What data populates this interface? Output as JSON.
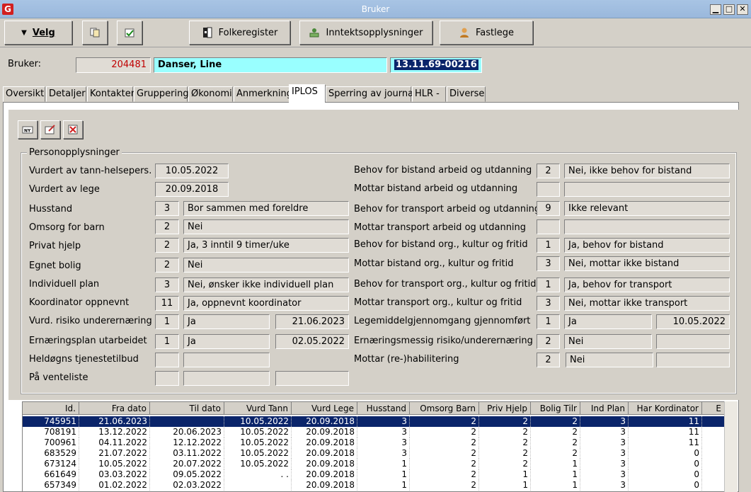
{
  "window": {
    "title": "Bruker",
    "min": "▁",
    "max": "□",
    "close": "✕",
    "app_icon": "G"
  },
  "toolbar": {
    "velg": "Velg",
    "folkeregister": "Folkeregister",
    "inntekt": "Inntektsopplysninger",
    "fastlege": "Fastlege"
  },
  "bruker": {
    "label": "Bruker:",
    "id": "204481",
    "name": "Danser, Line",
    "fnr": "13.11.69-00216"
  },
  "tabs": [
    "Oversikt",
    "Detaljer",
    "Kontakter",
    "Gruppering",
    "Økonomi",
    "Anmerkning",
    "IPLOS",
    "Sperring av journal",
    "HLR -",
    "Diverse"
  ],
  "group_title": "Personopplysninger",
  "left": [
    {
      "label": "Vurdert av tann-helsepers.",
      "date": "10.05.2022"
    },
    {
      "label": "Vurdert av lege",
      "date": "20.09.2018"
    },
    {
      "label": "Husstand",
      "code": "3",
      "text": "Bor sammen med foreldre"
    },
    {
      "label": "Omsorg for barn",
      "code": "2",
      "text": "Nei"
    },
    {
      "label": "Privat hjelp",
      "code": "2",
      "text": "Ja, 3 inntil 9 timer/uke"
    },
    {
      "label": "Egnet bolig",
      "code": "2",
      "text": "Nei"
    },
    {
      "label": "Individuell plan",
      "code": "3",
      "text": "Nei, ønsker ikke individuell plan"
    },
    {
      "label": "Koordinator oppnevnt",
      "code": "11",
      "text": "Ja, oppnevnt koordinator"
    },
    {
      "label": "Vurd. risiko underernæring",
      "code": "1",
      "text": "Ja",
      "date": "21.06.2023"
    },
    {
      "label": "Ernæringsplan utarbeidet",
      "code": "1",
      "text": "Ja",
      "date": "02.05.2022"
    },
    {
      "label": "Heldøgns tjenestetilbud",
      "code": "",
      "text": ""
    },
    {
      "label": "På venteliste",
      "code": "",
      "text": "",
      "date": ""
    }
  ],
  "right": [
    {
      "label": "Behov for bistand arbeid og utdanning",
      "code": "2",
      "text": "Nei, ikke behov for bistand"
    },
    {
      "label": "Mottar bistand arbeid og utdanning",
      "code": "",
      "text": ""
    },
    {
      "label": "Behov for transport arbeid og utdanning",
      "code": "9",
      "text": "Ikke relevant"
    },
    {
      "label": "Mottar transport arbeid og utdanning",
      "code": "",
      "text": ""
    },
    {
      "label": "Behov for bistand org., kultur og fritid",
      "code": "1",
      "text": "Ja, behov for bistand"
    },
    {
      "label": "Mottar bistand org., kultur og fritid",
      "code": "3",
      "text": "Nei, mottar ikke bistand"
    },
    {
      "label": "Behov for transport org., kultur og fritid",
      "code": "1",
      "text": "Ja, behov for transport"
    },
    {
      "label": "Mottar transport org., kultur og fritid",
      "code": "3",
      "text": "Nei, mottar ikke transport"
    },
    {
      "label": "Legemiddelgjennomgang gjennomført",
      "code": "1",
      "text": "Ja",
      "date": "10.05.2022"
    },
    {
      "label": "Ernæringsmessig risiko/underernæring",
      "code": "2",
      "text": "Nei",
      "date": ""
    },
    {
      "label": "Mottar (re-)habilitering",
      "code": "2",
      "text": "Nei",
      "date": ""
    }
  ],
  "grid": {
    "headers": [
      "Id.",
      "Fra dato",
      "Til dato",
      "Vurd Tann",
      "Vurd Lege",
      "Husstand",
      "Omsorg Barn",
      "Priv Hjelp",
      "Bolig Tilr",
      "Ind Plan",
      "Har Kordinator",
      "E"
    ],
    "rows": [
      [
        "745951",
        "21.06.2023",
        "",
        "10.05.2022",
        "20.09.2018",
        "3",
        "2",
        "2",
        "2",
        "3",
        "11"
      ],
      [
        "708191",
        "13.12.2022",
        "20.06.2023",
        "10.05.2022",
        "20.09.2018",
        "3",
        "2",
        "2",
        "2",
        "3",
        "11"
      ],
      [
        "700961",
        "04.11.2022",
        "12.12.2022",
        "10.05.2022",
        "20.09.2018",
        "3",
        "2",
        "2",
        "2",
        "3",
        "11"
      ],
      [
        "683529",
        "21.07.2022",
        "03.11.2022",
        "10.05.2022",
        "20.09.2018",
        "3",
        "2",
        "2",
        "2",
        "3",
        "0"
      ],
      [
        "673124",
        "10.05.2022",
        "20.07.2022",
        "10.05.2022",
        "20.09.2018",
        "1",
        "2",
        "2",
        "1",
        "3",
        "0"
      ],
      [
        "661649",
        "03.03.2022",
        "09.05.2022",
        ". .",
        "20.09.2018",
        "1",
        "2",
        "1",
        "1",
        "3",
        "0"
      ],
      [
        "657349",
        "01.02.2022",
        "02.03.2022",
        "",
        "20.09.2018",
        "1",
        "2",
        "1",
        "1",
        "3",
        "0"
      ]
    ]
  }
}
